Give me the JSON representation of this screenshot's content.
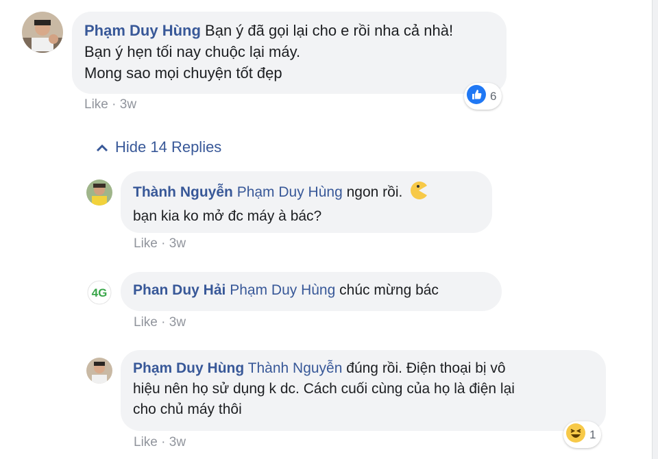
{
  "comment": {
    "author": "Phạm Duy Hùng",
    "lines": [
      "Bạn ý đã gọi lại cho e rồi nha cả nhà!",
      "Bạn ý hẹn tối nay chuộc lại máy.",
      "Mong sao mọi chuyện tốt đẹp"
    ],
    "like_label": "Like",
    "time": "3w",
    "reaction_count": "6"
  },
  "hide_replies_label": "Hide 14 Replies",
  "replies": [
    {
      "author": "Thành Nguyễn",
      "mention": "Phạm Duy Hùng",
      "text_line1": "ngon rồi.",
      "text_line2": "bạn kia ko mở đc máy à bác?",
      "like_label": "Like",
      "time": "3w"
    },
    {
      "author": "Phan Duy Hải",
      "mention": "Phạm Duy Hùng",
      "text": "chúc mừng bác",
      "like_label": "Like",
      "time": "3w"
    },
    {
      "author": "Phạm Duy Hùng",
      "mention": "Thành Nguyễn",
      "text_line1": "đúng rồi. Điện thoại bị vô",
      "text_line2": "hiệu nên họ sử dụng k dc. Cách cuối cùng của họ là điện lại",
      "text_line3": "cho chủ máy thôi",
      "like_label": "Like",
      "time": "3w",
      "reaction_count": "1"
    }
  ],
  "colors": {
    "link": "#385898",
    "bubble": "#f2f3f5",
    "meta": "#90949c",
    "like_blue": "#2078f4",
    "haha_yellow": "#f7c948"
  }
}
